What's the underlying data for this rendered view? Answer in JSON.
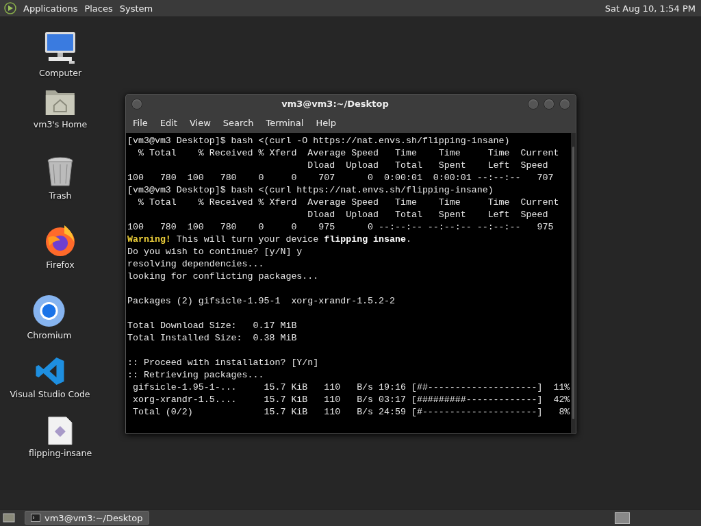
{
  "top_panel": {
    "menus": [
      "Applications",
      "Places",
      "System"
    ],
    "clock": "Sat Aug 10, 1:54 PM"
  },
  "desktop_icons": [
    {
      "label": "Computer"
    },
    {
      "label": "vm3's Home"
    },
    {
      "label": "Trash"
    },
    {
      "label": "Firefox"
    },
    {
      "label": "Chromium"
    },
    {
      "label": "Visual Studio Code"
    },
    {
      "label": "flipping-insane"
    }
  ],
  "terminal": {
    "title": "vm3@vm3:~/Desktop",
    "menu": [
      "File",
      "Edit",
      "View",
      "Search",
      "Terminal",
      "Help"
    ],
    "blocks": [
      [
        {
          "kind": "plain",
          "text": "[vm3@vm3 Desktop]$ bash <(curl -O https://nat.envs.sh/flipping-insane)"
        },
        {
          "kind": "plain",
          "text": "  % Total    % Received % Xferd  Average Speed   Time    Time     Time  Current"
        },
        {
          "kind": "plain",
          "text": "                                 Dload  Upload   Total   Spent    Left  Speed"
        },
        {
          "kind": "plain",
          "text": "100   780  100   780    0     0    707      0  0:00:01  0:00:01 --:--:--   707"
        },
        {
          "kind": "plain",
          "text": "[vm3@vm3 Desktop]$ bash <(curl https://nat.envs.sh/flipping-insane)"
        },
        {
          "kind": "plain",
          "text": "  % Total    % Received % Xferd  Average Speed   Time    Time     Time  Current"
        },
        {
          "kind": "plain",
          "text": "                                 Dload  Upload   Total   Spent    Left  Speed"
        },
        {
          "kind": "plain",
          "text": "100   780  100   780    0     0    975      0 --:--:-- --:--:-- --:--:--   975"
        },
        {
          "kind": "warning",
          "text": "**Warning!** This will turn your device **flipping insane**."
        },
        {
          "kind": "plain",
          "text": "Do you wish to continue? [y/N] y"
        },
        {
          "kind": "plain",
          "text": "resolving dependencies..."
        },
        {
          "kind": "plain",
          "text": "looking for conflicting packages..."
        }
      ],
      [
        {
          "kind": "plain",
          "text": "Packages (2) gifsicle-1.95-1  xorg-xrandr-1.5.2-2"
        }
      ],
      [
        {
          "kind": "plain",
          "text": "Total Download Size:   0.17 MiB"
        },
        {
          "kind": "plain",
          "text": "Total Installed Size:  0.38 MiB"
        }
      ],
      [
        {
          "kind": "plain",
          "text": ":: Proceed with installation? [Y/n]"
        },
        {
          "kind": "plain",
          "text": ":: Retrieving packages..."
        },
        {
          "kind": "plain",
          "text": " gifsicle-1.95-1-...     15.7 KiB   110   B/s 19:16 [##--------------------]  11%"
        },
        {
          "kind": "plain",
          "text": " xorg-xrandr-1.5....     15.7 KiB   110   B/s 03:17 [#########-------------]  42%"
        },
        {
          "kind": "plain",
          "text": " Total (0/2)             15.7 KiB   110   B/s 24:59 [#---------------------]   8%"
        }
      ]
    ]
  },
  "taskbar": {
    "tasks": [
      {
        "label": "vm3@vm3:~/Desktop",
        "selected": true
      }
    ]
  }
}
